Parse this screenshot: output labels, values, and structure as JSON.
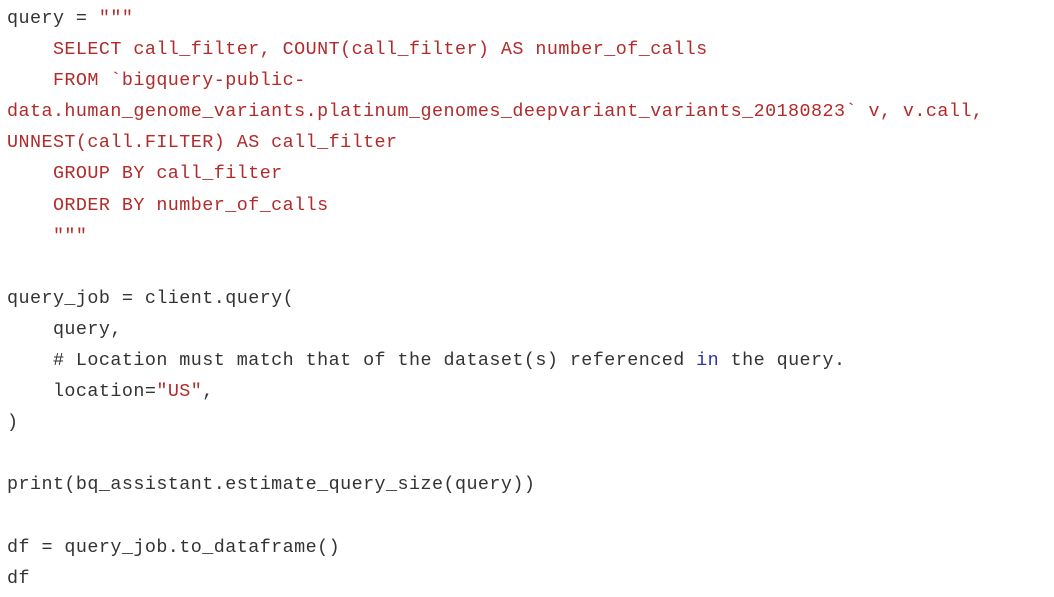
{
  "code": {
    "line1": {
      "var": "query = ",
      "str": "\"\"\""
    },
    "line2": "    SELECT call_filter, COUNT(call_filter) AS number_of_calls",
    "line3": "    FROM `bigquery-public-",
    "line4": "data.human_genome_variants.platinum_genomes_deepvariant_variants_20180823` v, v.call,",
    "line5": "UNNEST(call.FILTER) AS call_filter",
    "line6": "    GROUP BY call_filter",
    "line7": "    ORDER BY number_of_calls",
    "line8": "    \"\"\"",
    "line9": "",
    "line10": "query_job = client.query(",
    "line11": "    query,",
    "line12": {
      "before": "    # Location must match that of the dataset(s) referenced ",
      "kw": "in",
      "after": " the query."
    },
    "line13": {
      "before": "    location=",
      "str": "\"US\"",
      "after": ","
    },
    "line14": ")",
    "line15": "",
    "line16": "print(bq_assistant.estimate_query_size(query))",
    "line17": "",
    "line18": "df = query_job.to_dataframe()",
    "line19": "df"
  },
  "colors": {
    "string": "#b22a2a",
    "keyword": "#3333aa",
    "text": "#333333"
  }
}
